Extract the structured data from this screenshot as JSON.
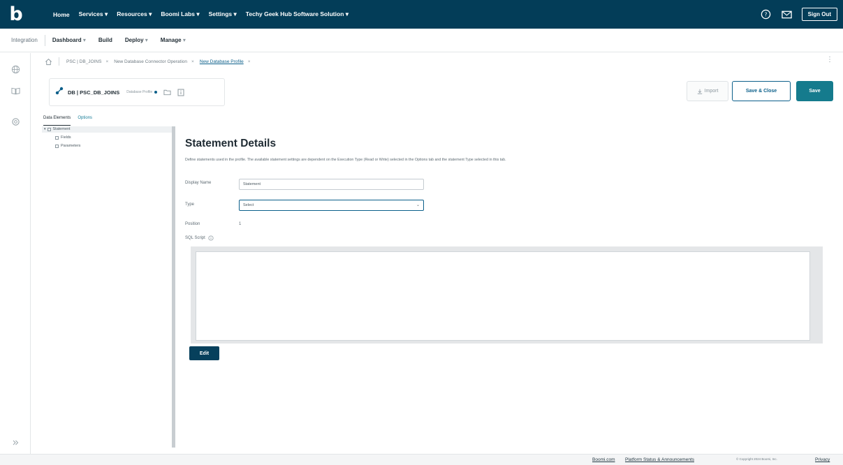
{
  "topnav": {
    "logo": "b",
    "items": [
      "Home",
      "Services ▾",
      "Resources ▾",
      "Boomi Labs ▾",
      "Settings ▾",
      "Techy Geek Hub Software Solution ▾"
    ],
    "help_icon": "help-circle-icon",
    "mail_icon": "envelope-icon",
    "sign_out": "Sign Out",
    "bg_color": "#033d58"
  },
  "subnav": {
    "integration": "Integration",
    "items": [
      "Dashboard",
      "Build",
      "Deploy",
      "Manage"
    ],
    "caret": "▾"
  },
  "rail": {
    "icons": [
      "globe-icon",
      "book-icon",
      "settings-icon",
      "collapse-icon"
    ]
  },
  "breadcrumb": {
    "home_icon": "home-icon",
    "items": [
      "PSC | DB_JOINS",
      "New Database Connector Operation",
      "New Database Profile"
    ],
    "close_char": "×",
    "kebab": "⋮"
  },
  "component": {
    "icon": "database-connector-icon",
    "title": "DB | PSC_DB_JOINS",
    "type_label": "Database Profile"
  },
  "actions": {
    "import": "Import",
    "save_close": "Save & Close",
    "save": "Save",
    "save_color": "#157b8d"
  },
  "tree": {
    "tabs": [
      "Data Elements",
      "Options"
    ],
    "nodes": [
      "Statement",
      "Fields",
      "Parameters"
    ]
  },
  "main": {
    "title": "Statement Details",
    "description": "Define statements used in the profile. The available statement settings are dependent on the Execution Type (Read or Write) selected in the Options tab and the statement Type selected in this tab.",
    "display_name_label": "Display Name",
    "display_name_value": "Statement",
    "type_label": "Type",
    "type_value": "Select",
    "position_label": "Position",
    "position_value": "1",
    "sql_label": "SQL Script",
    "edit_button": "Edit"
  },
  "footer": {
    "boomi": "Boomi.com",
    "status": "Platform Status & Announcements",
    "copyright": "© Copyright 2024 Boomi, Inc.",
    "privacy": "Privacy"
  }
}
